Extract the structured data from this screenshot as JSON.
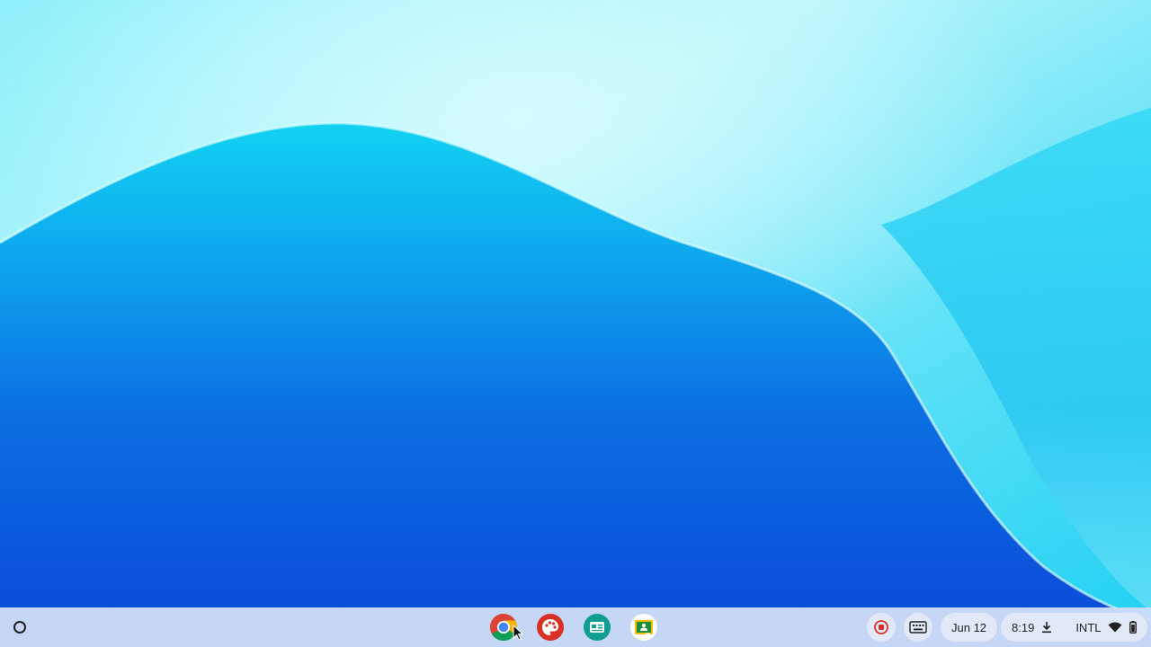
{
  "wallpaper": {
    "colors": {
      "deep_blue": "#0b4ad8",
      "mid_blue": "#1277e8",
      "cyan": "#12d1f0",
      "light_cyan": "#b6f7fb"
    }
  },
  "shelf": {
    "background": "#cedcf6",
    "launcher": {
      "icon": "launcher-circle-icon"
    },
    "pinned_apps": [
      {
        "name": "Chrome",
        "icon": "chrome-icon"
      },
      {
        "name": "Canvas",
        "icon": "palette-icon"
      },
      {
        "name": "Screencast",
        "icon": "screencast-icon"
      },
      {
        "name": "Google Classroom",
        "icon": "classroom-icon"
      }
    ]
  },
  "status_area": {
    "screen_record_icon": "stop-recording-icon",
    "keyboard_icon": "keyboard-icon",
    "date": "Jun 12",
    "time": "8:19",
    "download_icon": "download-icon",
    "ime": "INTL",
    "wifi_icon": "wifi-icon",
    "battery_icon": "battery-icon",
    "record_color": "#d93025"
  }
}
